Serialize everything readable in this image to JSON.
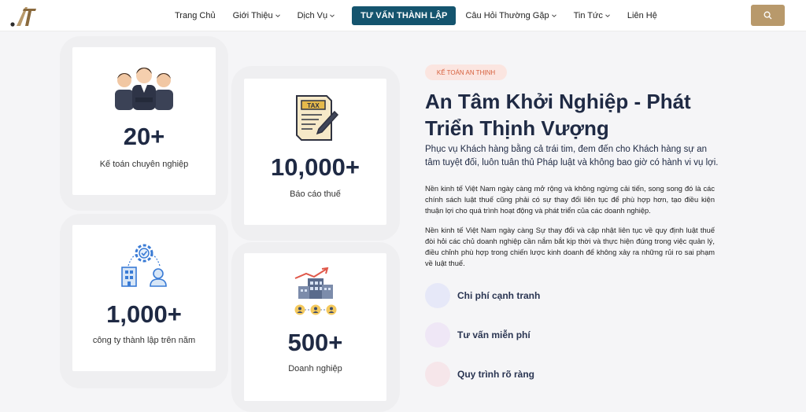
{
  "nav": {
    "items": [
      {
        "label": "Trang Chủ",
        "has_dropdown": false
      },
      {
        "label": "Giới Thiệu",
        "has_dropdown": true
      },
      {
        "label": "Dịch Vụ",
        "has_dropdown": true
      }
    ],
    "cta_label": "TƯ VẤN THÀNH LẬP",
    "items_after": [
      {
        "label": "Câu Hỏi Thường Gặp",
        "has_dropdown": true
      },
      {
        "label": "Tin Tức",
        "has_dropdown": true
      },
      {
        "label": "Liên Hệ",
        "has_dropdown": false
      }
    ],
    "search_icon": "search-icon",
    "accent_color": "#14546e",
    "search_color": "#b8996b"
  },
  "stats": [
    {
      "number": "20+",
      "label": "Kế toán chuyên nghiệp",
      "icon": "accountants-icon"
    },
    {
      "number": "10,000+",
      "label": "Báo cáo thuế",
      "icon": "tax-report-icon"
    },
    {
      "number": "1,000+",
      "label": "công ty thành lập trên năm",
      "icon": "company-setup-icon"
    },
    {
      "number": "500+",
      "label": "Doanh nghiệp",
      "icon": "enterprise-icon"
    }
  ],
  "about": {
    "badge": "KẾ TOÁN AN THỊNH",
    "headline_line1": "An Tâm Khởi Nghiệp - Phát",
    "headline_line2": "Triển Thịnh Vượng",
    "lead": "Phục vụ Khách hàng bằng cả trái tim, đem đến cho Khách hàng sự an tâm tuyệt đối, luôn tuân thủ Pháp luật và không bao giờ có hành vi vụ lợi.",
    "paragraph1": "Nền kinh tế Việt Nam ngày càng mở rộng và không ngừng cải tiến, song song đó là các chính sách luật thuế cũng phải có sự thay đổi liên tục để phù hợp hơn, tạo điều kiện thuận lợi cho quá trình hoạt động và phát triển của các doanh nghiệp.",
    "paragraph2": "Nền kinh tế Việt Nam ngày càng Sự thay đổi và cập nhật liên tục về quy định luật thuế đòi hỏi các chủ doanh nghiệp cần nắm bắt kịp thời và thực hiện đúng trong việc quản lý, điều chỉnh phù hợp trong chiến lược kinh doanh để không xảy ra những rủi ro sai phạm về luật thuế."
  },
  "features": [
    {
      "label": "Chi phí cạnh tranh",
      "color": "#e6e8f8"
    },
    {
      "label": "Tư vấn miễn phí",
      "color": "#efe7f6"
    },
    {
      "label": "Quy trình rõ ràng",
      "color": "#f6e6ea"
    }
  ]
}
